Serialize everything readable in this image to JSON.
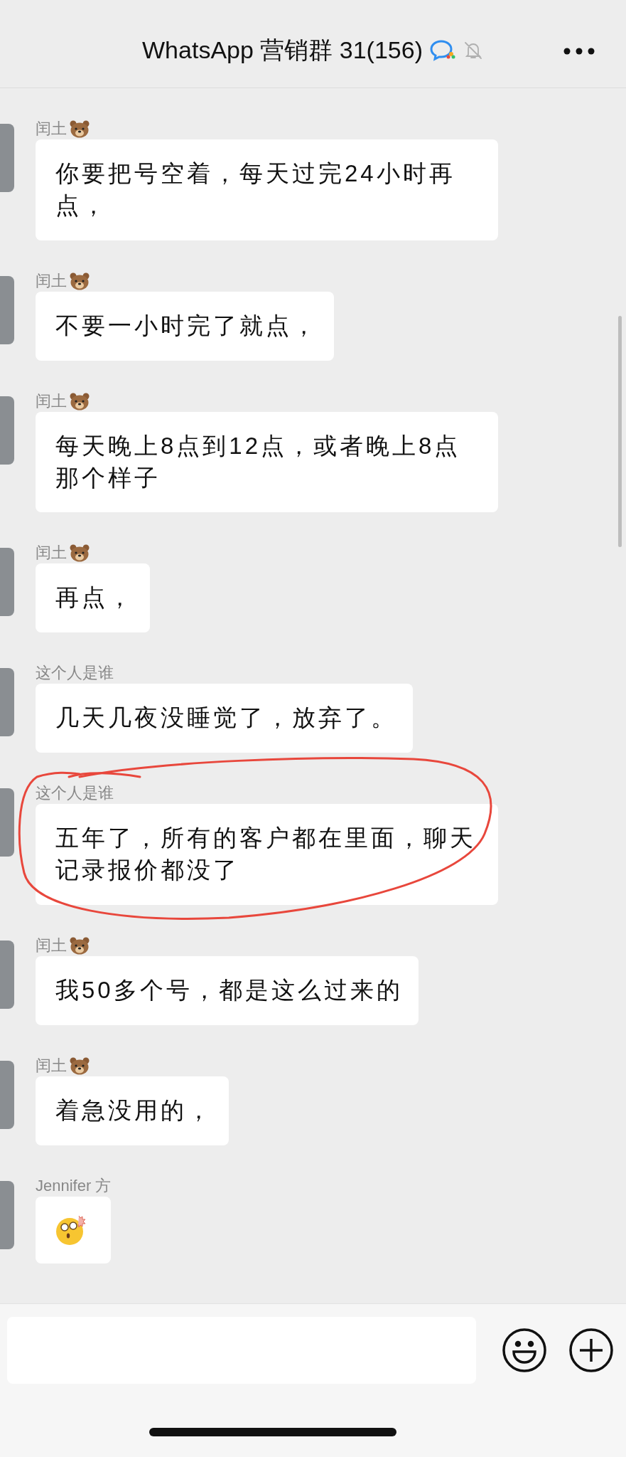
{
  "header": {
    "title": "WhatsApp 营销群 31(156)",
    "muted": true
  },
  "messages": [
    {
      "sender": "闰土",
      "badge": true,
      "kind": "text",
      "text": "你要把号空着，每天过完24小时再点，",
      "circled": false
    },
    {
      "sender": "闰土",
      "badge": true,
      "kind": "text",
      "text": "不要一小时完了就点，",
      "circled": false
    },
    {
      "sender": "闰土",
      "badge": true,
      "kind": "text",
      "text": "每天晚上8点到12点，或者晚上8点那个样子",
      "circled": false
    },
    {
      "sender": "闰土",
      "badge": true,
      "kind": "text",
      "text": "再点，",
      "circled": false
    },
    {
      "sender": "这个人是谁",
      "badge": false,
      "kind": "text",
      "text": "几天几夜没睡觉了，放弃了。",
      "circled": false
    },
    {
      "sender": "这个人是谁",
      "badge": false,
      "kind": "text",
      "text": "五年了，所有的客户都在里面，聊天记录报价都没了",
      "circled": true
    },
    {
      "sender": "闰土",
      "badge": true,
      "kind": "text",
      "text": "我50多个号，都是这么过来的",
      "circled": false
    },
    {
      "sender": "闰土",
      "badge": true,
      "kind": "text",
      "text": "着急没用的，",
      "circled": false
    },
    {
      "sender": "Jennifer 方",
      "badge": false,
      "kind": "emoji",
      "circled": false
    }
  ]
}
